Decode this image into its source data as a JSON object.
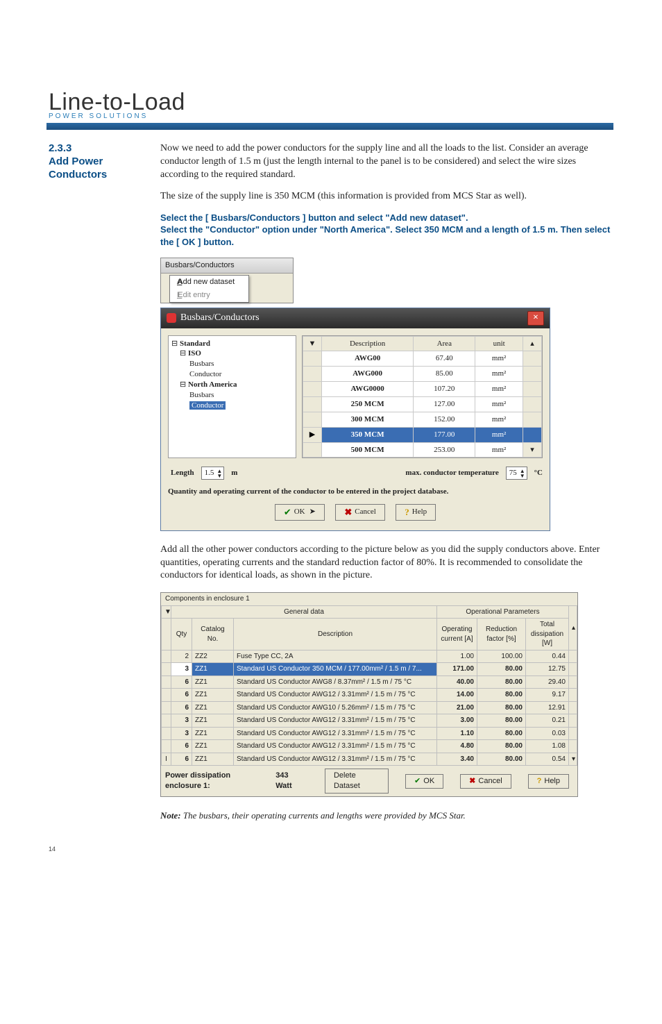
{
  "brand": {
    "title": "Line-to-Load",
    "subtitle": "POWER SOLUTIONS"
  },
  "section": {
    "num": "2.3.3",
    "title": "Add Power Conductors"
  },
  "para1": "Now we need to add the power conductors for the supply line and all the loads to the list. Consider an average conductor length of 1.5 m (just the length internal to the panel is to be considered) and select the wire sizes according to the required standard.",
  "para2": "The size of the supply line is 350 MCM (this information is provided from MCS Star as well).",
  "instr1": "Select the [ Busbars/Conductors ] button and select \"Add new dataset\".",
  "instr2": "Select the \"Conductor\" option under \"North America\". Select 350 MCM and a length of 1.5 m. Then select the [ OK ] button.",
  "win1": {
    "dropdownTitle": "Busbars/Conductors",
    "menu": {
      "add": "Add new dataset",
      "edit": "Edit entry"
    },
    "dialogTitle": "Busbars/Conductors",
    "tree": {
      "root": "Standard",
      "iso": "ISO",
      "busbars": "Busbars",
      "conductor": "Conductor",
      "na": "North America"
    },
    "gridHeaders": {
      "desc": "Description",
      "area": "Area",
      "unit": "unit"
    },
    "rows": [
      {
        "desc": "AWG00",
        "area": "67.40",
        "unit": "mm²"
      },
      {
        "desc": "AWG000",
        "area": "85.00",
        "unit": "mm²"
      },
      {
        "desc": "AWG0000",
        "area": "107.20",
        "unit": "mm²"
      },
      {
        "desc": "250 MCM",
        "area": "127.00",
        "unit": "mm²"
      },
      {
        "desc": "300 MCM",
        "area": "152.00",
        "unit": "mm²"
      },
      {
        "desc": "350 MCM",
        "area": "177.00",
        "unit": "mm²",
        "sel": true
      },
      {
        "desc": "500 MCM",
        "area": "253.00",
        "unit": "mm²"
      }
    ],
    "lengthLabel": "Length",
    "lengthVal": "1.5",
    "lengthUnit": "m",
    "tempLabel": "max. conductor temperature",
    "tempVal": "75",
    "tempUnit": "°C",
    "footerNote": "Quantity and operating current of the conductor to be entered in the project database.",
    "btns": {
      "ok": "OK",
      "cancel": "Cancel",
      "help": "Help"
    }
  },
  "para3": "Add all the other power conductors according to the picture below as you did the supply conductors above. Enter quantities, operating currents and the standard reduction factor of 80%. It is recommended to consolidate the conductors for identical loads, as shown in the picture.",
  "win2": {
    "title": "Components in enclosure 1",
    "colGroups": {
      "general": "General data",
      "op": "Operational Parameters"
    },
    "headers": {
      "qty": "Qty",
      "cat": "Catalog No.",
      "desc": "Description",
      "cur": "Operating current [A]",
      "red": "Reduction factor [%]",
      "tot": "Total dissipation [W]"
    },
    "rows": [
      {
        "qty": "2",
        "cat": "ZZ2",
        "desc": "Fuse Type CC, 2A",
        "cur": "1.00",
        "red": "100.00",
        "tot": "0.44",
        "sel": false
      },
      {
        "qty": "3",
        "cat": "ZZ1",
        "desc": "Standard US Conductor 350 MCM / 177.00mm² / 1.5 m / 7...",
        "cur": "171.00",
        "red": "80.00",
        "tot": "12.75",
        "sel": true,
        "strong": true
      },
      {
        "qty": "6",
        "cat": "ZZ1",
        "desc": "Standard US Conductor AWG8 / 8.37mm² / 1.5 m / 75 °C",
        "cur": "40.00",
        "red": "80.00",
        "tot": "29.40",
        "sel": false,
        "strong": true
      },
      {
        "qty": "6",
        "cat": "ZZ1",
        "desc": "Standard US Conductor AWG12 / 3.31mm² / 1.5 m / 75 °C",
        "cur": "14.00",
        "red": "80.00",
        "tot": "9.17",
        "sel": false,
        "strong": true
      },
      {
        "qty": "6",
        "cat": "ZZ1",
        "desc": "Standard US Conductor AWG10 / 5.26mm² / 1.5 m / 75 °C",
        "cur": "21.00",
        "red": "80.00",
        "tot": "12.91",
        "sel": false,
        "strong": true
      },
      {
        "qty": "3",
        "cat": "ZZ1",
        "desc": "Standard US Conductor AWG12 / 3.31mm² / 1.5 m / 75 °C",
        "cur": "3.00",
        "red": "80.00",
        "tot": "0.21",
        "sel": false,
        "strong": true
      },
      {
        "qty": "3",
        "cat": "ZZ1",
        "desc": "Standard US Conductor AWG12 / 3.31mm² / 1.5 m / 75 °C",
        "cur": "1.10",
        "red": "80.00",
        "tot": "0.03",
        "sel": false,
        "strong": true
      },
      {
        "qty": "6",
        "cat": "ZZ1",
        "desc": "Standard US Conductor AWG12 / 3.31mm² / 1.5 m / 75 °C",
        "cur": "4.80",
        "red": "80.00",
        "tot": "1.08",
        "sel": false,
        "strong": true
      },
      {
        "qty": "6",
        "cat": "ZZ1",
        "desc": "Standard US Conductor AWG12 / 3.31mm² / 1.5 m / 75 °C",
        "cur": "3.40",
        "red": "80.00",
        "tot": "0.54",
        "sel": false,
        "strong": true
      }
    ],
    "footer": {
      "dissLabel": "Power dissipation enclosure 1:",
      "dissVal": "343 Watt",
      "delete": "Delete Dataset",
      "ok": "OK",
      "cancel": "Cancel",
      "help": "Help"
    }
  },
  "note": "Note: The busbars, their operating currents and lengths were provided by MCS Star.",
  "pageNum": "14"
}
